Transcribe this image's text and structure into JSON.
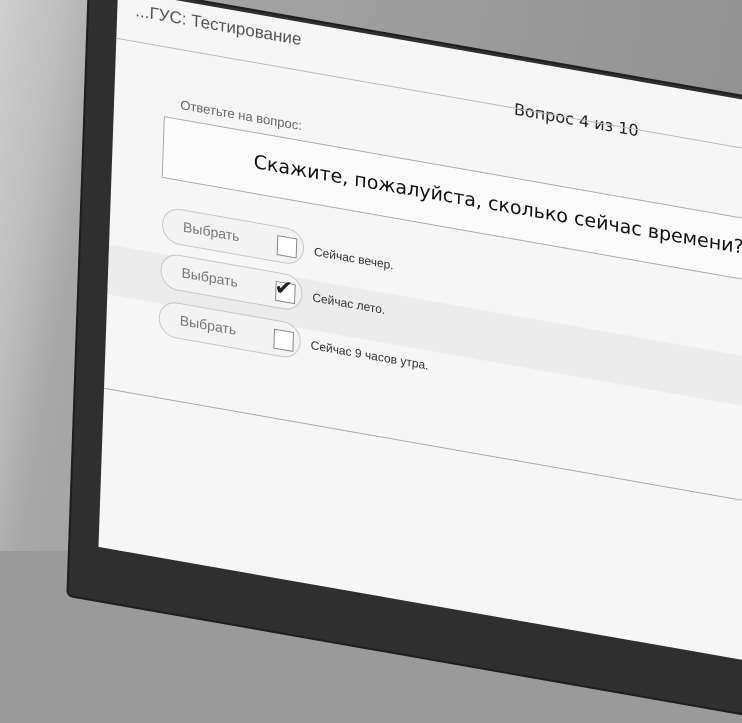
{
  "app": {
    "title": "...ГУС: Тестирование",
    "question_counter": "Вопрос 4 из 10"
  },
  "question": {
    "prompt_label": "Ответьте на вопрос:",
    "text": "Скажите, пожалуйста, сколько сейчас времени?"
  },
  "answers": [
    {
      "button_label": "Выбрать",
      "text": "Сейчас вечер.",
      "checked": false
    },
    {
      "button_label": "Выбрать",
      "text": "Сейчас лето.",
      "checked": true
    },
    {
      "button_label": "Выбрать",
      "text": "Сейчас 9 часов утра.",
      "checked": false
    }
  ],
  "icons": {
    "checkmark": "check-icon"
  }
}
